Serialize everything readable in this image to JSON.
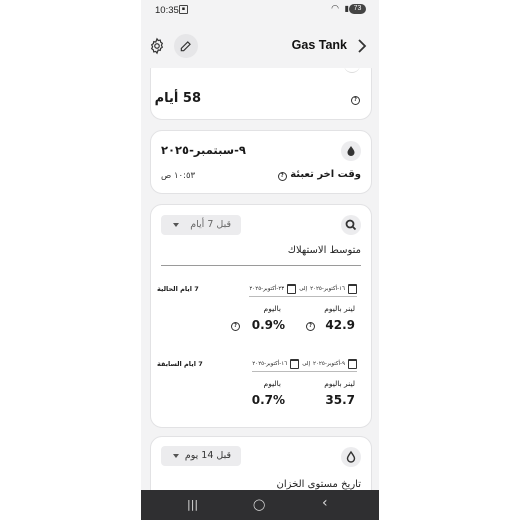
{
  "status_bar": {
    "time": "10:35",
    "battery": "73"
  },
  "header": {
    "title": "Gas Tank",
    "icons": [
      "gear-icon",
      "edit-icon",
      "chevron-right-icon"
    ]
  },
  "days_card": {
    "value": "58 أيام"
  },
  "refill_card": {
    "date": "٩-سبتمبر-٢٠٢٥",
    "time": "١٠:٥٣ ص",
    "label": "وقت اخر تعبئة"
  },
  "consumption_card": {
    "dropdown": "قبل 7 أيام",
    "title": "متوسط الاستهلاك",
    "current": {
      "label": "7 ايام الحالية",
      "from": "١٦-أكتوبر-٢٠٢٥",
      "to_word": "إلى",
      "to": "٢٣-أكتوبر-٢٠٢٥",
      "unit_liters": "لينر باليوم",
      "unit_percent": "باليوم",
      "liters": "42.9",
      "percent": "0.9%"
    },
    "previous": {
      "label": "7 ايام السابقة",
      "from": "٩-أكتوبر-٢٠٢٥",
      "to_word": "إلى",
      "to": "١٦-أكتوبر-٢٠٢٥",
      "unit_liters": "لينر باليوم",
      "unit_percent": "باليوم",
      "liters": "35.7",
      "percent": "0.7%"
    }
  },
  "history_card": {
    "dropdown": "قبل 14 يوم",
    "title": "تاريخ مستوى الخزان"
  },
  "nav": {
    "recents": "|||",
    "home": "◯",
    "back": "‹"
  }
}
